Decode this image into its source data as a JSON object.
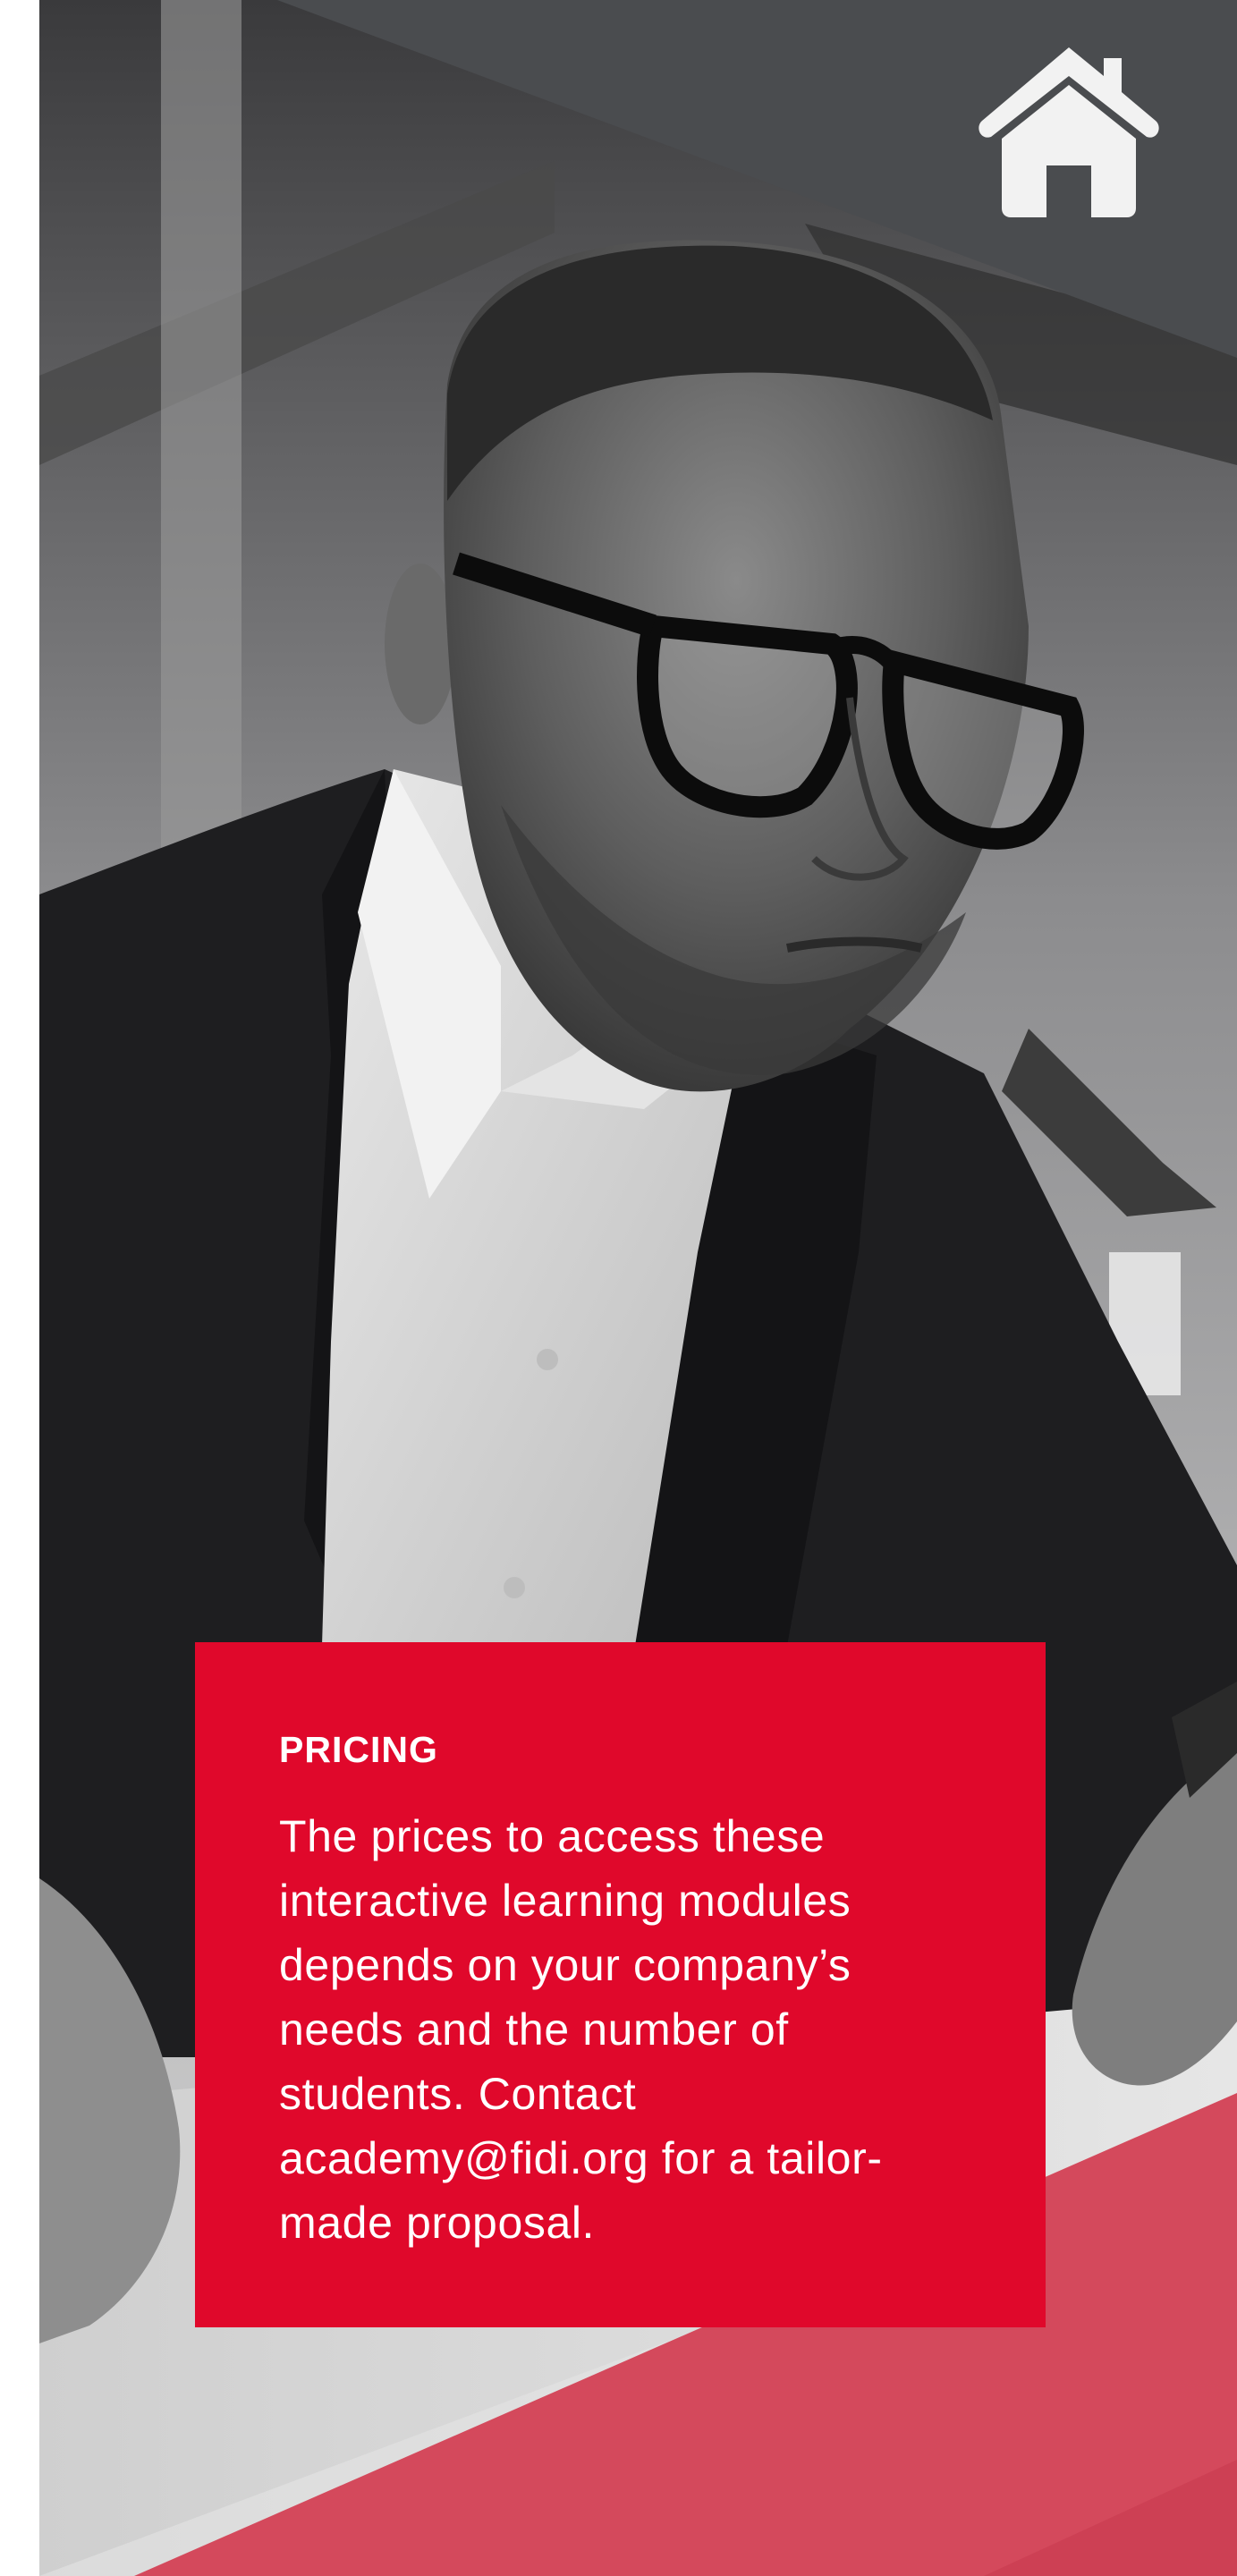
{
  "header": {
    "home_icon": "home-icon",
    "home_icon_color": "#f2f2f2",
    "banner_color": "#4a4c4f"
  },
  "hero": {
    "description": "black-and-white photo of a man with glasses looking at a screen"
  },
  "pricing": {
    "title": "PRICING",
    "lines": [
      "The prices to access these",
      "interactive learning modules",
      "depends on your company’s",
      "needs and the number of",
      "students. Contact",
      "academy@fidi.org for a tailor-",
      "made proposal."
    ],
    "background_color": "#e0082b",
    "text_color": "#ffffff"
  },
  "footer": {
    "accent_color": "#d4495c"
  }
}
